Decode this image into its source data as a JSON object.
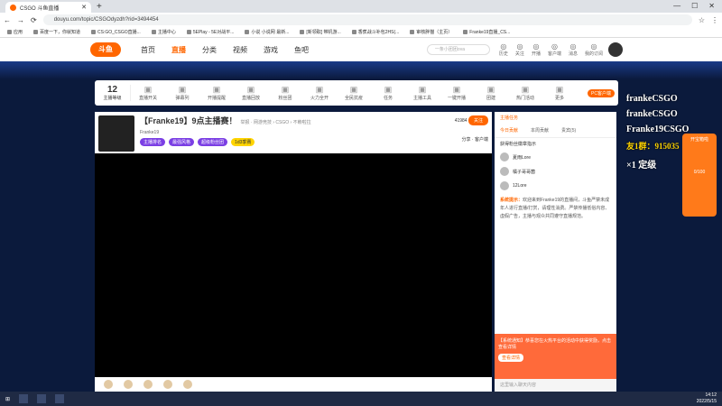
{
  "browser": {
    "tab_title": "CSGO 斗鱼直播",
    "url": "douyu.com/topic/CSGOdyzdh?rid=3494454",
    "bookmarks": [
      "应用",
      "百度一下，你就知道",
      "CS:GO_CSGO直播...",
      "主播中心",
      "5EPlay - 5E对战平...",
      "小说 小说网 最新...",
      "[新领取] 带机游...",
      "香蕉战斗补包2HS(...",
      "审核胖猫（主页）",
      "Franke19直播_CS..."
    ]
  },
  "site": {
    "logo": "斗鱼",
    "nav": [
      "首页",
      "直播",
      "分类",
      "视频",
      "游戏",
      "鱼吧"
    ],
    "nav_active": 1,
    "search_placeholder": "一条小团团ova",
    "top_icons": [
      "历史",
      "关注",
      "开播",
      "客户端",
      "消息",
      "我的订阅"
    ]
  },
  "toolbar": {
    "level": "12",
    "level_label": "主播等级",
    "items": [
      "直播开关",
      "弹幕列",
      "开播提醒",
      "直播回放",
      "粉丝团",
      "火力全开",
      "全民抗疫",
      "任务",
      "主播工具",
      "一键开播",
      "团建",
      "热门活动",
      "更多"
    ],
    "pc_button": "PC客户端"
  },
  "room": {
    "title": "【Franke19】9点主播赛！",
    "subtitle": "举报 · 网游竞技 › CSGO › 不赖啦拉",
    "anchor": "Franke19",
    "tags": [
      "主播排名",
      "最强风格",
      "超级粉丝团",
      "1d3季赛"
    ],
    "follows": "41984",
    "follow_btn": "关注",
    "share": "分享",
    "client": "客户端"
  },
  "sidebar": {
    "tabs": [
      "今日贡献",
      "本周贡献",
      "贵宾(5)"
    ],
    "active_tab": 0,
    "head": "主播任务",
    "sub": "获得粉丝徽章指示",
    "ranks": [
      "夏雨Lore",
      "橘子哥哥菌",
      "12Lore"
    ],
    "system_label": "系统提示：",
    "system_text": "欢迎来到Franke19的直播间，斗鱼严禁未成年人进行直播/打赏，请理性消费。严禁传播低俗内容、虚假广告，主播与观众共同遵守直播规范。",
    "ad_text": "【系统通知】恭喜您在火热平台的活动中获得奖励，点击查看详情",
    "ad_btn": "查看详情",
    "chat_placeholder": "这里输入聊天内容"
  },
  "overlay": {
    "lines": [
      "frankeCSGO",
      "frankeCSGO",
      "Franke19CSGO",
      "友1群：915035"
    ],
    "bottom": "×1 定级"
  },
  "promo": {
    "title": "开宝箱啦",
    "progress": "0/100"
  },
  "taskbar": {
    "time": "14:12",
    "date": "2022/5/15"
  }
}
